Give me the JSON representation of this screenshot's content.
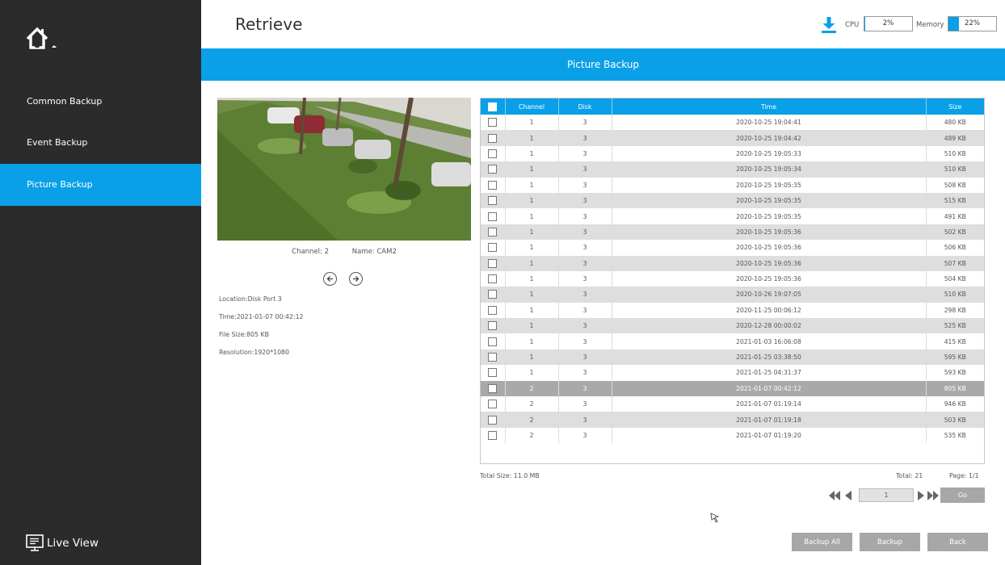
{
  "sidebar": {
    "items": [
      {
        "label": "Common Backup"
      },
      {
        "label": "Event Backup"
      },
      {
        "label": "Picture Backup"
      }
    ],
    "live_view_label": "Live View"
  },
  "header": {
    "title": "Retrieve",
    "cpu_label": "CPU",
    "cpu_value": "2%",
    "memory_label": "Memory",
    "memory_value": "22%"
  },
  "banner": {
    "title": "Picture Backup"
  },
  "preview": {
    "channel": "Channel: 2",
    "name": "Name: CAM2",
    "location": "Location:Disk Port 3",
    "time": "Time:2021-01-07 00:42:12",
    "file_size": "File Size:805 KB",
    "resolution": "Resolution:1920*1080"
  },
  "table": {
    "columns": [
      "Channel",
      "Disk",
      "Time",
      "Size"
    ],
    "rows": [
      {
        "channel": "1",
        "disk": "3",
        "time": "2020-10-25 19:04:41",
        "size": "480 KB"
      },
      {
        "channel": "1",
        "disk": "3",
        "time": "2020-10-25 19:04:42",
        "size": "489 KB"
      },
      {
        "channel": "1",
        "disk": "3",
        "time": "2020-10-25 19:05:33",
        "size": "510 KB"
      },
      {
        "channel": "1",
        "disk": "3",
        "time": "2020-10-25 19:05:34",
        "size": "510 KB"
      },
      {
        "channel": "1",
        "disk": "3",
        "time": "2020-10-25 19:05:35",
        "size": "508 KB"
      },
      {
        "channel": "1",
        "disk": "3",
        "time": "2020-10-25 19:05:35",
        "size": "515 KB"
      },
      {
        "channel": "1",
        "disk": "3",
        "time": "2020-10-25 19:05:35",
        "size": "491 KB"
      },
      {
        "channel": "1",
        "disk": "3",
        "time": "2020-10-25 19:05:36",
        "size": "502 KB"
      },
      {
        "channel": "1",
        "disk": "3",
        "time": "2020-10-25 19:05:36",
        "size": "506 KB"
      },
      {
        "channel": "1",
        "disk": "3",
        "time": "2020-10-25 19:05:36",
        "size": "507 KB"
      },
      {
        "channel": "1",
        "disk": "3",
        "time": "2020-10-25 19:05:36",
        "size": "504 KB"
      },
      {
        "channel": "1",
        "disk": "3",
        "time": "2020-10-26 19:07:05",
        "size": "510 KB"
      },
      {
        "channel": "1",
        "disk": "3",
        "time": "2020-11-25 00:06:12",
        "size": "298 KB"
      },
      {
        "channel": "1",
        "disk": "3",
        "time": "2020-12-28 00:00:02",
        "size": "525 KB"
      },
      {
        "channel": "1",
        "disk": "3",
        "time": "2021-01-03 16:06:08",
        "size": "415 KB"
      },
      {
        "channel": "1",
        "disk": "3",
        "time": "2021-01-25 03:38:50",
        "size": "595 KB"
      },
      {
        "channel": "1",
        "disk": "3",
        "time": "2021-01-25 04:31:37",
        "size": "593 KB"
      },
      {
        "channel": "2",
        "disk": "3",
        "time": "2021-01-07 00:42:12",
        "size": "805 KB",
        "selected": true
      },
      {
        "channel": "2",
        "disk": "3",
        "time": "2021-01-07 01:19:14",
        "size": "946 KB"
      },
      {
        "channel": "2",
        "disk": "3",
        "time": "2021-01-07 01:19:18",
        "size": "503 KB"
      },
      {
        "channel": "2",
        "disk": "3",
        "time": "2021-01-07 01:19:20",
        "size": "535 KB"
      }
    ]
  },
  "footer": {
    "total_size": "Total Size: 11.0 MB",
    "total": "Total: 21",
    "page": "Page: 1/1",
    "page_input": "1",
    "go_label": "Go"
  },
  "actions": {
    "backup_all": "Backup All",
    "backup": "Backup",
    "back": "Back"
  },
  "colors": {
    "accent": "#0aa0e8",
    "sidebar_bg": "#2b2b2b",
    "button_gray": "#a7a7a7",
    "selected_row": "#a9a9a9"
  },
  "icons": [
    "home-icon",
    "download-icon",
    "prev-arrow-icon",
    "next-arrow-icon",
    "first-page-icon",
    "prev-page-icon",
    "next-page-icon",
    "last-page-icon",
    "monitor-icon",
    "cursor-icon"
  ]
}
